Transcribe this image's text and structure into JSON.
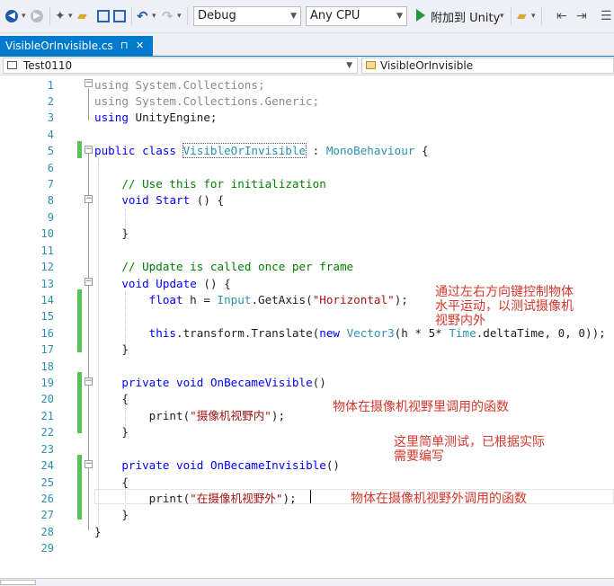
{
  "toolbar": {
    "config": "Debug",
    "platform": "Any CPU",
    "run_label": "附加到 Unity"
  },
  "tab": {
    "title": "VisibleOrInvisible.cs",
    "pin": "⊓",
    "close": "✕"
  },
  "nav": {
    "project": "Test0110",
    "class": "VisibleOrInvisible"
  },
  "code": {
    "line_numbers": [
      "1",
      "2",
      "3",
      "4",
      "5",
      "6",
      "7",
      "8",
      "9",
      "10",
      "11",
      "12",
      "13",
      "14",
      "15",
      "16",
      "17",
      "18",
      "19",
      "20",
      "21",
      "22",
      "23",
      "24",
      "25",
      "26",
      "27",
      "28",
      "29"
    ],
    "lines": [
      [
        [
          "gray",
          "using System.Collections;"
        ]
      ],
      [
        [
          "gray",
          "using System.Collections.Generic;"
        ]
      ],
      [
        [
          "kw",
          "using"
        ],
        [
          "plain",
          " UnityEngine;"
        ]
      ],
      [],
      [
        [
          "kw",
          "public class "
        ],
        [
          "typ-dotted",
          "VisibleOrInvisible"
        ],
        [
          "plain",
          " : "
        ],
        [
          "typ",
          "MonoBehaviour"
        ],
        [
          "plain",
          " {"
        ]
      ],
      [],
      [
        [
          "plain",
          "    "
        ],
        [
          "cmt",
          "// Use this for initialization"
        ]
      ],
      [
        [
          "plain",
          "    "
        ],
        [
          "kw",
          "void"
        ],
        [
          "plain",
          " "
        ],
        [
          "kw",
          "Start"
        ],
        [
          "plain",
          " () {"
        ]
      ],
      [],
      [
        [
          "plain",
          "    }"
        ]
      ],
      [],
      [
        [
          "plain",
          "    "
        ],
        [
          "cmt",
          "// Update is called once per frame"
        ]
      ],
      [
        [
          "plain",
          "    "
        ],
        [
          "kw",
          "void"
        ],
        [
          "plain",
          " "
        ],
        [
          "kw",
          "Update"
        ],
        [
          "plain",
          " () {"
        ]
      ],
      [
        [
          "plain",
          "        "
        ],
        [
          "kw",
          "float"
        ],
        [
          "plain",
          " h = "
        ],
        [
          "typ",
          "Input"
        ],
        [
          "plain",
          ".GetAxis("
        ],
        [
          "str",
          "\"Horizontal\""
        ],
        [
          "plain",
          ");"
        ]
      ],
      [],
      [
        [
          "plain",
          "        "
        ],
        [
          "kw",
          "this"
        ],
        [
          "plain",
          ".transform.Translate("
        ],
        [
          "kw",
          "new"
        ],
        [
          "plain",
          " "
        ],
        [
          "typ",
          "Vector3"
        ],
        [
          "plain",
          "(h * 5* "
        ],
        [
          "typ",
          "Time"
        ],
        [
          "plain",
          ".deltaTime, 0, 0));"
        ]
      ],
      [
        [
          "plain",
          "    }"
        ]
      ],
      [],
      [
        [
          "plain",
          "    "
        ],
        [
          "kw",
          "private void"
        ],
        [
          "plain",
          " "
        ],
        [
          "kw",
          "OnBecameVisible"
        ],
        [
          "plain",
          "()"
        ]
      ],
      [
        [
          "plain",
          "    {"
        ]
      ],
      [
        [
          "plain",
          "        print("
        ],
        [
          "str",
          "\"摄像机视野内\""
        ],
        [
          "plain",
          ");"
        ]
      ],
      [
        [
          "plain",
          "    }"
        ]
      ],
      [],
      [
        [
          "plain",
          "    "
        ],
        [
          "kw",
          "private void"
        ],
        [
          "plain",
          " "
        ],
        [
          "kw",
          "OnBecameInvisible"
        ],
        [
          "plain",
          "()"
        ]
      ],
      [
        [
          "plain",
          "    {"
        ]
      ],
      [
        [
          "plain",
          "        print("
        ],
        [
          "str",
          "\"在摄像机视野外\""
        ],
        [
          "plain",
          ");"
        ]
      ],
      [
        [
          "plain",
          "    }"
        ]
      ],
      [
        [
          "plain",
          "}"
        ]
      ],
      []
    ]
  },
  "notes": {
    "n1_l1": "通过左右方向键控制物体",
    "n1_l2": "水平运动，以测试摄像机",
    "n1_l3": "视野内外",
    "n2": "物体在摄像机视野里调用的函数",
    "n3_l1": "这里简单测试，已根据实际",
    "n3_l2": "需要编写",
    "n4": "物体在摄像机视野外调用的函数"
  },
  "colors": {
    "accent": "#007acc",
    "keyword": "#0000ff",
    "type": "#2b91af",
    "string": "#a31515",
    "comment": "#008000",
    "change_marker": "#57c157",
    "note": "#d4372b"
  }
}
